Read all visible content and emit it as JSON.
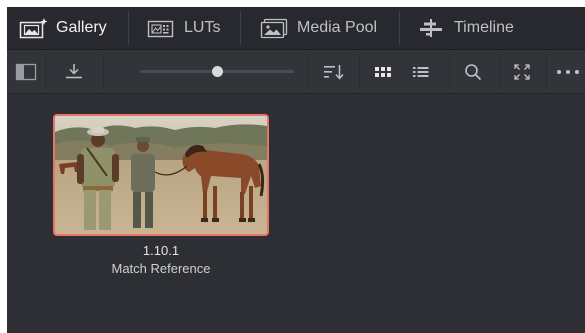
{
  "tabs": [
    {
      "label": "Gallery",
      "icon": "gallery-icon",
      "active": true
    },
    {
      "label": "LUTs",
      "icon": "luts-icon",
      "active": false
    },
    {
      "label": "Media Pool",
      "icon": "media-pool-icon",
      "active": false
    },
    {
      "label": "Timeline",
      "icon": "timeline-icon",
      "active": false
    }
  ],
  "toolbar": {
    "icons": [
      "panel-toggle-icon",
      "grab-still-icon",
      "zoom-slider",
      "sort-icon",
      "grid-view-icon",
      "list-view-icon",
      "search-icon",
      "expand-icon",
      "more-options-icon"
    ],
    "thumbnail_zoom": 0.5
  },
  "stills": [
    {
      "id": "1.10.1",
      "label": "Match Reference",
      "selected": true
    }
  ],
  "colors": {
    "background": "#2e2f35",
    "tabbar": "#28292e",
    "toolbar": "#333439",
    "selection_border": "#e8736a",
    "text_active": "#f2f2f4",
    "text_inactive": "#bfc0c5"
  }
}
